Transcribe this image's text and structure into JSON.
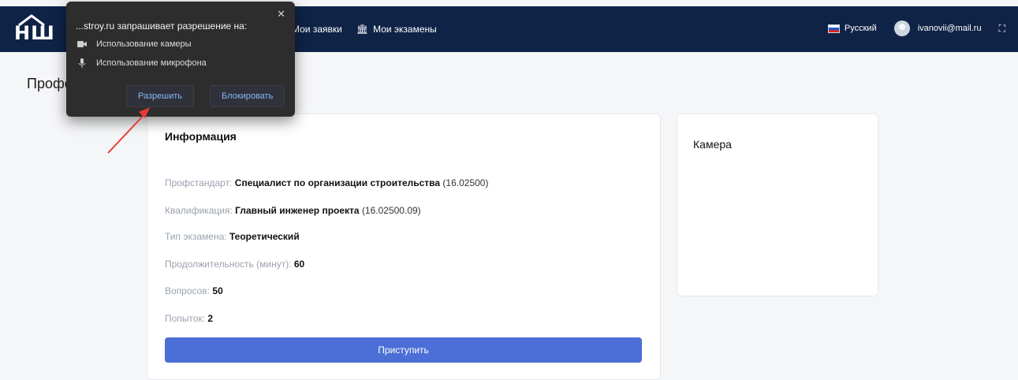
{
  "header": {
    "logo_text": "НШ",
    "nav": [
      {
        "label": "Мои заявки",
        "icon": "none"
      },
      {
        "label": "Мои экзамены",
        "icon": "bank-icon"
      }
    ],
    "language": "Русский",
    "user_email": "ivanovii@mail.ru"
  },
  "page": {
    "title": "Профессиональный экзамен"
  },
  "info": {
    "title": "Информация",
    "rows": [
      {
        "label": "Профстандарт:",
        "value": "Специалист по организации строительства",
        "extra": "(16.02500)"
      },
      {
        "label": "Квалификация:",
        "value": "Главный инженер проекта",
        "extra": "(16.02500.09)"
      },
      {
        "label": "Тип экзамена:",
        "value": "Теоретический",
        "extra": ""
      },
      {
        "label": "Продолжительность (минут):",
        "value": "60",
        "extra": ""
      },
      {
        "label": "Вопросов:",
        "value": "50",
        "extra": ""
      },
      {
        "label": "Попыток:",
        "value": "2",
        "extra": ""
      }
    ],
    "start_label": "Приступить"
  },
  "camera": {
    "title": "Камера"
  },
  "popup": {
    "title": "...stroy.ru запрашивает разрешение на:",
    "items": [
      {
        "label": "Использование камеры",
        "icon": "camera-icon"
      },
      {
        "label": "Использование микрофона",
        "icon": "mic-icon"
      }
    ],
    "allow_label": "Разрешить",
    "block_label": "Блокировать"
  },
  "colors": {
    "header_bg": "#0f2347",
    "primary": "#4b6fd6",
    "arrow": "#e53935"
  }
}
